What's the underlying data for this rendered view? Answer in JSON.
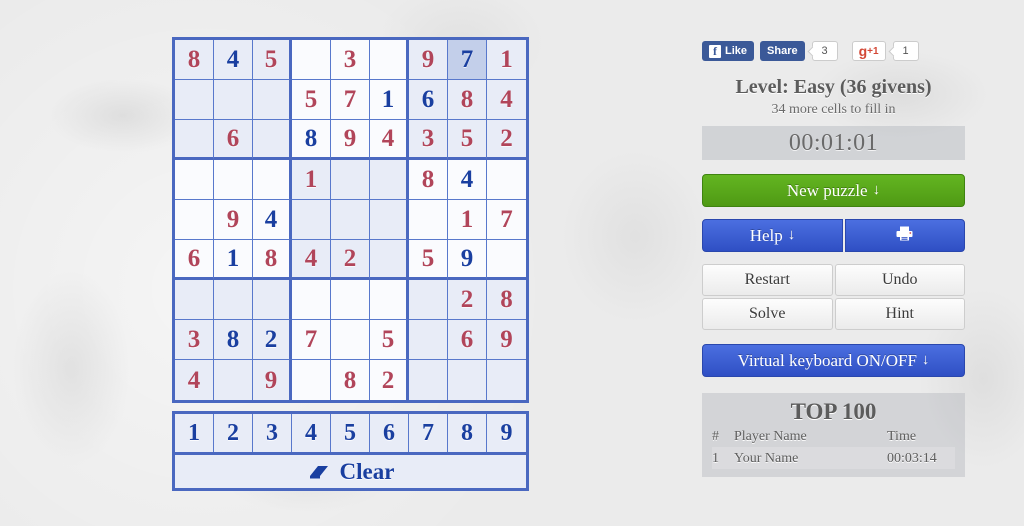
{
  "board": {
    "rows": [
      [
        {
          "v": "8",
          "t": "given"
        },
        {
          "v": "4",
          "t": "user"
        },
        {
          "v": "5",
          "t": "given"
        },
        {
          "v": "",
          "t": ""
        },
        {
          "v": "3",
          "t": "given"
        },
        {
          "v": "",
          "t": ""
        },
        {
          "v": "9",
          "t": "given"
        },
        {
          "v": "7",
          "t": "user",
          "sel": true
        },
        {
          "v": "1",
          "t": "given"
        }
      ],
      [
        {
          "v": "",
          "t": ""
        },
        {
          "v": "",
          "t": ""
        },
        {
          "v": "",
          "t": ""
        },
        {
          "v": "5",
          "t": "given"
        },
        {
          "v": "7",
          "t": "given"
        },
        {
          "v": "1",
          "t": "user"
        },
        {
          "v": "6",
          "t": "user"
        },
        {
          "v": "8",
          "t": "given"
        },
        {
          "v": "4",
          "t": "given"
        }
      ],
      [
        {
          "v": "",
          "t": ""
        },
        {
          "v": "6",
          "t": "given"
        },
        {
          "v": "",
          "t": ""
        },
        {
          "v": "8",
          "t": "user"
        },
        {
          "v": "9",
          "t": "given"
        },
        {
          "v": "4",
          "t": "given"
        },
        {
          "v": "3",
          "t": "given"
        },
        {
          "v": "5",
          "t": "given"
        },
        {
          "v": "2",
          "t": "given"
        }
      ],
      [
        {
          "v": "",
          "t": ""
        },
        {
          "v": "",
          "t": ""
        },
        {
          "v": "",
          "t": ""
        },
        {
          "v": "1",
          "t": "given"
        },
        {
          "v": "",
          "t": ""
        },
        {
          "v": "",
          "t": ""
        },
        {
          "v": "8",
          "t": "given"
        },
        {
          "v": "4",
          "t": "user"
        },
        {
          "v": "",
          "t": ""
        }
      ],
      [
        {
          "v": "",
          "t": ""
        },
        {
          "v": "9",
          "t": "given"
        },
        {
          "v": "4",
          "t": "user"
        },
        {
          "v": "",
          "t": ""
        },
        {
          "v": "",
          "t": ""
        },
        {
          "v": "",
          "t": ""
        },
        {
          "v": "",
          "t": ""
        },
        {
          "v": "1",
          "t": "given"
        },
        {
          "v": "7",
          "t": "given"
        }
      ],
      [
        {
          "v": "6",
          "t": "given"
        },
        {
          "v": "1",
          "t": "user"
        },
        {
          "v": "8",
          "t": "given"
        },
        {
          "v": "4",
          "t": "given"
        },
        {
          "v": "2",
          "t": "given"
        },
        {
          "v": "",
          "t": ""
        },
        {
          "v": "5",
          "t": "given"
        },
        {
          "v": "9",
          "t": "user"
        },
        {
          "v": "",
          "t": ""
        }
      ],
      [
        {
          "v": "",
          "t": ""
        },
        {
          "v": "",
          "t": ""
        },
        {
          "v": "",
          "t": ""
        },
        {
          "v": "",
          "t": ""
        },
        {
          "v": "",
          "t": ""
        },
        {
          "v": "",
          "t": ""
        },
        {
          "v": "",
          "t": ""
        },
        {
          "v": "2",
          "t": "given"
        },
        {
          "v": "8",
          "t": "given"
        }
      ],
      [
        {
          "v": "3",
          "t": "given"
        },
        {
          "v": "8",
          "t": "user"
        },
        {
          "v": "2",
          "t": "user"
        },
        {
          "v": "7",
          "t": "given"
        },
        {
          "v": "",
          "t": ""
        },
        {
          "v": "5",
          "t": "given"
        },
        {
          "v": "",
          "t": ""
        },
        {
          "v": "6",
          "t": "given"
        },
        {
          "v": "9",
          "t": "given"
        }
      ],
      [
        {
          "v": "4",
          "t": "given"
        },
        {
          "v": "",
          "t": ""
        },
        {
          "v": "9",
          "t": "given"
        },
        {
          "v": "",
          "t": ""
        },
        {
          "v": "8",
          "t": "given"
        },
        {
          "v": "2",
          "t": "given"
        },
        {
          "v": "",
          "t": ""
        },
        {
          "v": "",
          "t": ""
        },
        {
          "v": "",
          "t": ""
        }
      ]
    ],
    "numpad": [
      "1",
      "2",
      "3",
      "4",
      "5",
      "6",
      "7",
      "8",
      "9"
    ],
    "clear_label": "Clear",
    "clear_icon": "eraser-icon"
  },
  "panel": {
    "social": {
      "facebook_like": "Like",
      "facebook_share": "Share",
      "facebook_count": "3",
      "gplus_label": "g+1",
      "gplus_g": "g",
      "gplus_plus_one": "+1",
      "gplus_count": "1"
    },
    "level": "Level: Easy (36 givens)",
    "remaining": "34 more cells to fill in",
    "timer": "00:01:01",
    "new_puzzle": "New puzzle",
    "help": "Help",
    "print_icon": "printer-icon",
    "restart": "Restart",
    "undo": "Undo",
    "solve": "Solve",
    "hint": "Hint",
    "virtual_keyboard": "Virtual keyboard ON/OFF",
    "dropdown_arrow": "↓",
    "top100": {
      "title": "TOP 100",
      "headers": {
        "rank": "#",
        "player": "Player Name",
        "time": "Time"
      },
      "rows": [
        {
          "rank": "1",
          "player": "Your Name",
          "time": "00:03:14"
        }
      ]
    }
  },
  "colors": {
    "given_digit": "#b1455a",
    "user_digit": "#1a3fa0",
    "grid_border": "#4a68c0",
    "cell_light": "#fafbfe",
    "cell_alt": "#e8ecf7",
    "cell_selected": "#c3cfea",
    "green_button": "#4f9a14",
    "blue_button": "#2f4fc4",
    "facebook_blue": "#3b5998",
    "page_background": "#ebebeb"
  }
}
